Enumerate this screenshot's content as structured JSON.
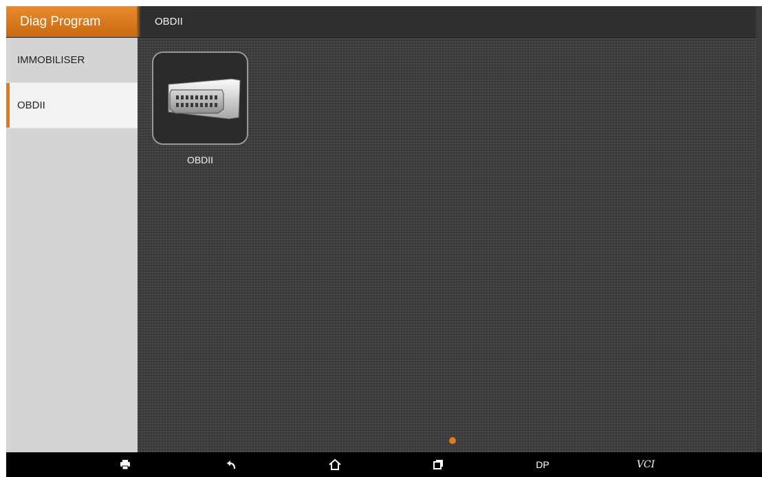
{
  "header": {
    "app_title": "Diag Program",
    "breadcrumb": "OBDII"
  },
  "sidebar": {
    "items": [
      {
        "label": "IMMOBILISER",
        "active": false
      },
      {
        "label": "OBDII",
        "active": true
      }
    ]
  },
  "main": {
    "tiles": [
      {
        "label": "OBDII",
        "icon": "obd-connector-icon"
      }
    ],
    "pager": {
      "current_page": 1,
      "total_pages": 1
    }
  },
  "navbar": {
    "items": [
      {
        "icon": "print-icon"
      },
      {
        "icon": "back-icon"
      },
      {
        "icon": "home-icon"
      },
      {
        "icon": "recent-apps-icon"
      },
      {
        "label": "DP"
      },
      {
        "label": "VCI"
      }
    ]
  },
  "colors": {
    "accent": "#e37a1a",
    "titlebar": "#2f2f2f",
    "sidebar": "#d4d4d4",
    "background": "#3b3b3b"
  }
}
